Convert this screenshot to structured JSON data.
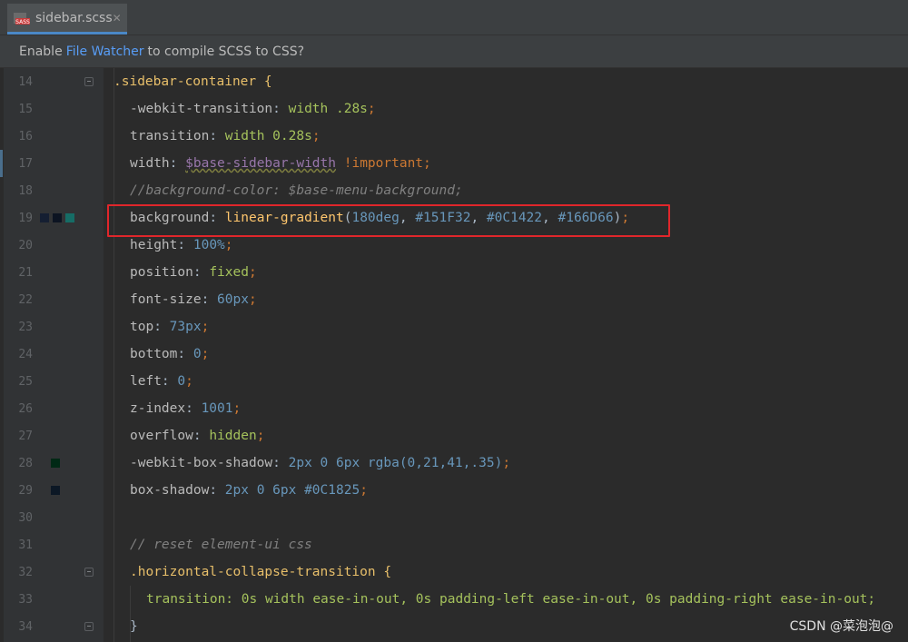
{
  "tab": {
    "icon": "sass-file-icon",
    "label": "sidebar.scss",
    "close": "✕"
  },
  "notice": {
    "prefix": "Enable",
    "link": "File Watcher",
    "suffix": "to compile SCSS to CSS?"
  },
  "colors": {
    "swatch_a": "#151F32",
    "swatch_b": "#0C1422",
    "swatch_c": "#166D66",
    "swatch_d": "#002915",
    "swatch_e": "#0C1825",
    "highlight": "#e0262b"
  },
  "lines": [
    {
      "n": "14",
      "t": ".sidebar-container {"
    },
    {
      "n": "15",
      "p": "-webkit-transition",
      "v": "width .28s"
    },
    {
      "n": "16",
      "p": "transition",
      "v": "width 0.28s"
    },
    {
      "n": "17",
      "p": "width",
      "v1": "$base-sidebar-width",
      "v2": "!important"
    },
    {
      "n": "18",
      "t": "//background-color: $base-menu-background;"
    },
    {
      "n": "19",
      "p": "background",
      "fn": "linear-gradient",
      "args": "180deg",
      "c1": "#151F32",
      "c2": "#0C1422",
      "c3": "#166D66"
    },
    {
      "n": "20",
      "p": "height",
      "v": "100%"
    },
    {
      "n": "21",
      "p": "position",
      "v": "fixed"
    },
    {
      "n": "22",
      "p": "font-size",
      "v": "60px"
    },
    {
      "n": "23",
      "p": "top",
      "v": "73px"
    },
    {
      "n": "24",
      "p": "bottom",
      "v": "0"
    },
    {
      "n": "25",
      "p": "left",
      "v": "0"
    },
    {
      "n": "26",
      "p": "z-index",
      "v": "1001"
    },
    {
      "n": "27",
      "p": "overflow",
      "v": "hidden"
    },
    {
      "n": "28",
      "p": "-webkit-box-shadow",
      "v": "2px 0 6px rgba(0,21,41,.35)"
    },
    {
      "n": "29",
      "p": "box-shadow",
      "v": "2px 0 6px #0C1825"
    },
    {
      "n": "30",
      "t": ""
    },
    {
      "n": "31",
      "t": "// reset element-ui css"
    },
    {
      "n": "32",
      "t": ".horizontal-collapse-transition {"
    },
    {
      "n": "33",
      "t": "transition: 0s width ease-in-out, 0s padding-left ease-in-out, 0s padding-right ease-in-out;"
    },
    {
      "n": "34",
      "t": "}"
    }
  ],
  "watermark": "CSDN @菜泡泡@"
}
